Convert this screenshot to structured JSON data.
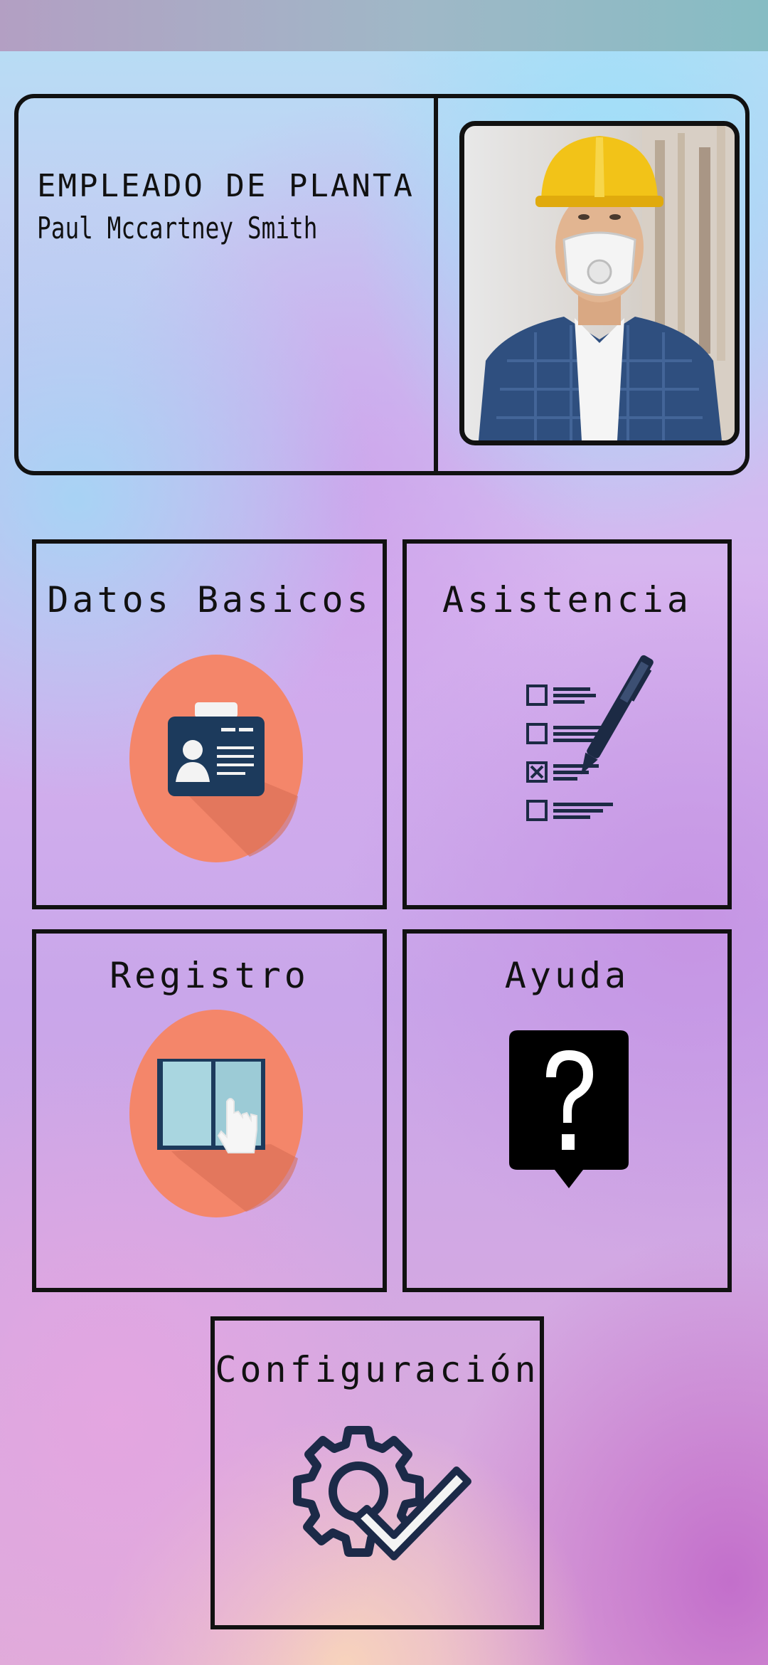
{
  "profile": {
    "role": "EMPLEADO DE PLANTA",
    "name": "Paul Mccartney Smith"
  },
  "menu": {
    "datos_basicos": {
      "label": "Datos Basicos",
      "icon": "id-card-icon"
    },
    "asistencia": {
      "label": "Asistencia",
      "icon": "checklist-pen-icon"
    },
    "registro": {
      "label": "Registro",
      "icon": "book-touch-icon"
    },
    "ayuda": {
      "label": "Ayuda",
      "icon": "question-icon"
    },
    "configuracion": {
      "label": "Configuración",
      "icon": "gear-check-icon"
    }
  },
  "colors": {
    "icon_circle": "#f4866a",
    "icon_navy": "#1c3a5c",
    "outline": "#111111"
  }
}
